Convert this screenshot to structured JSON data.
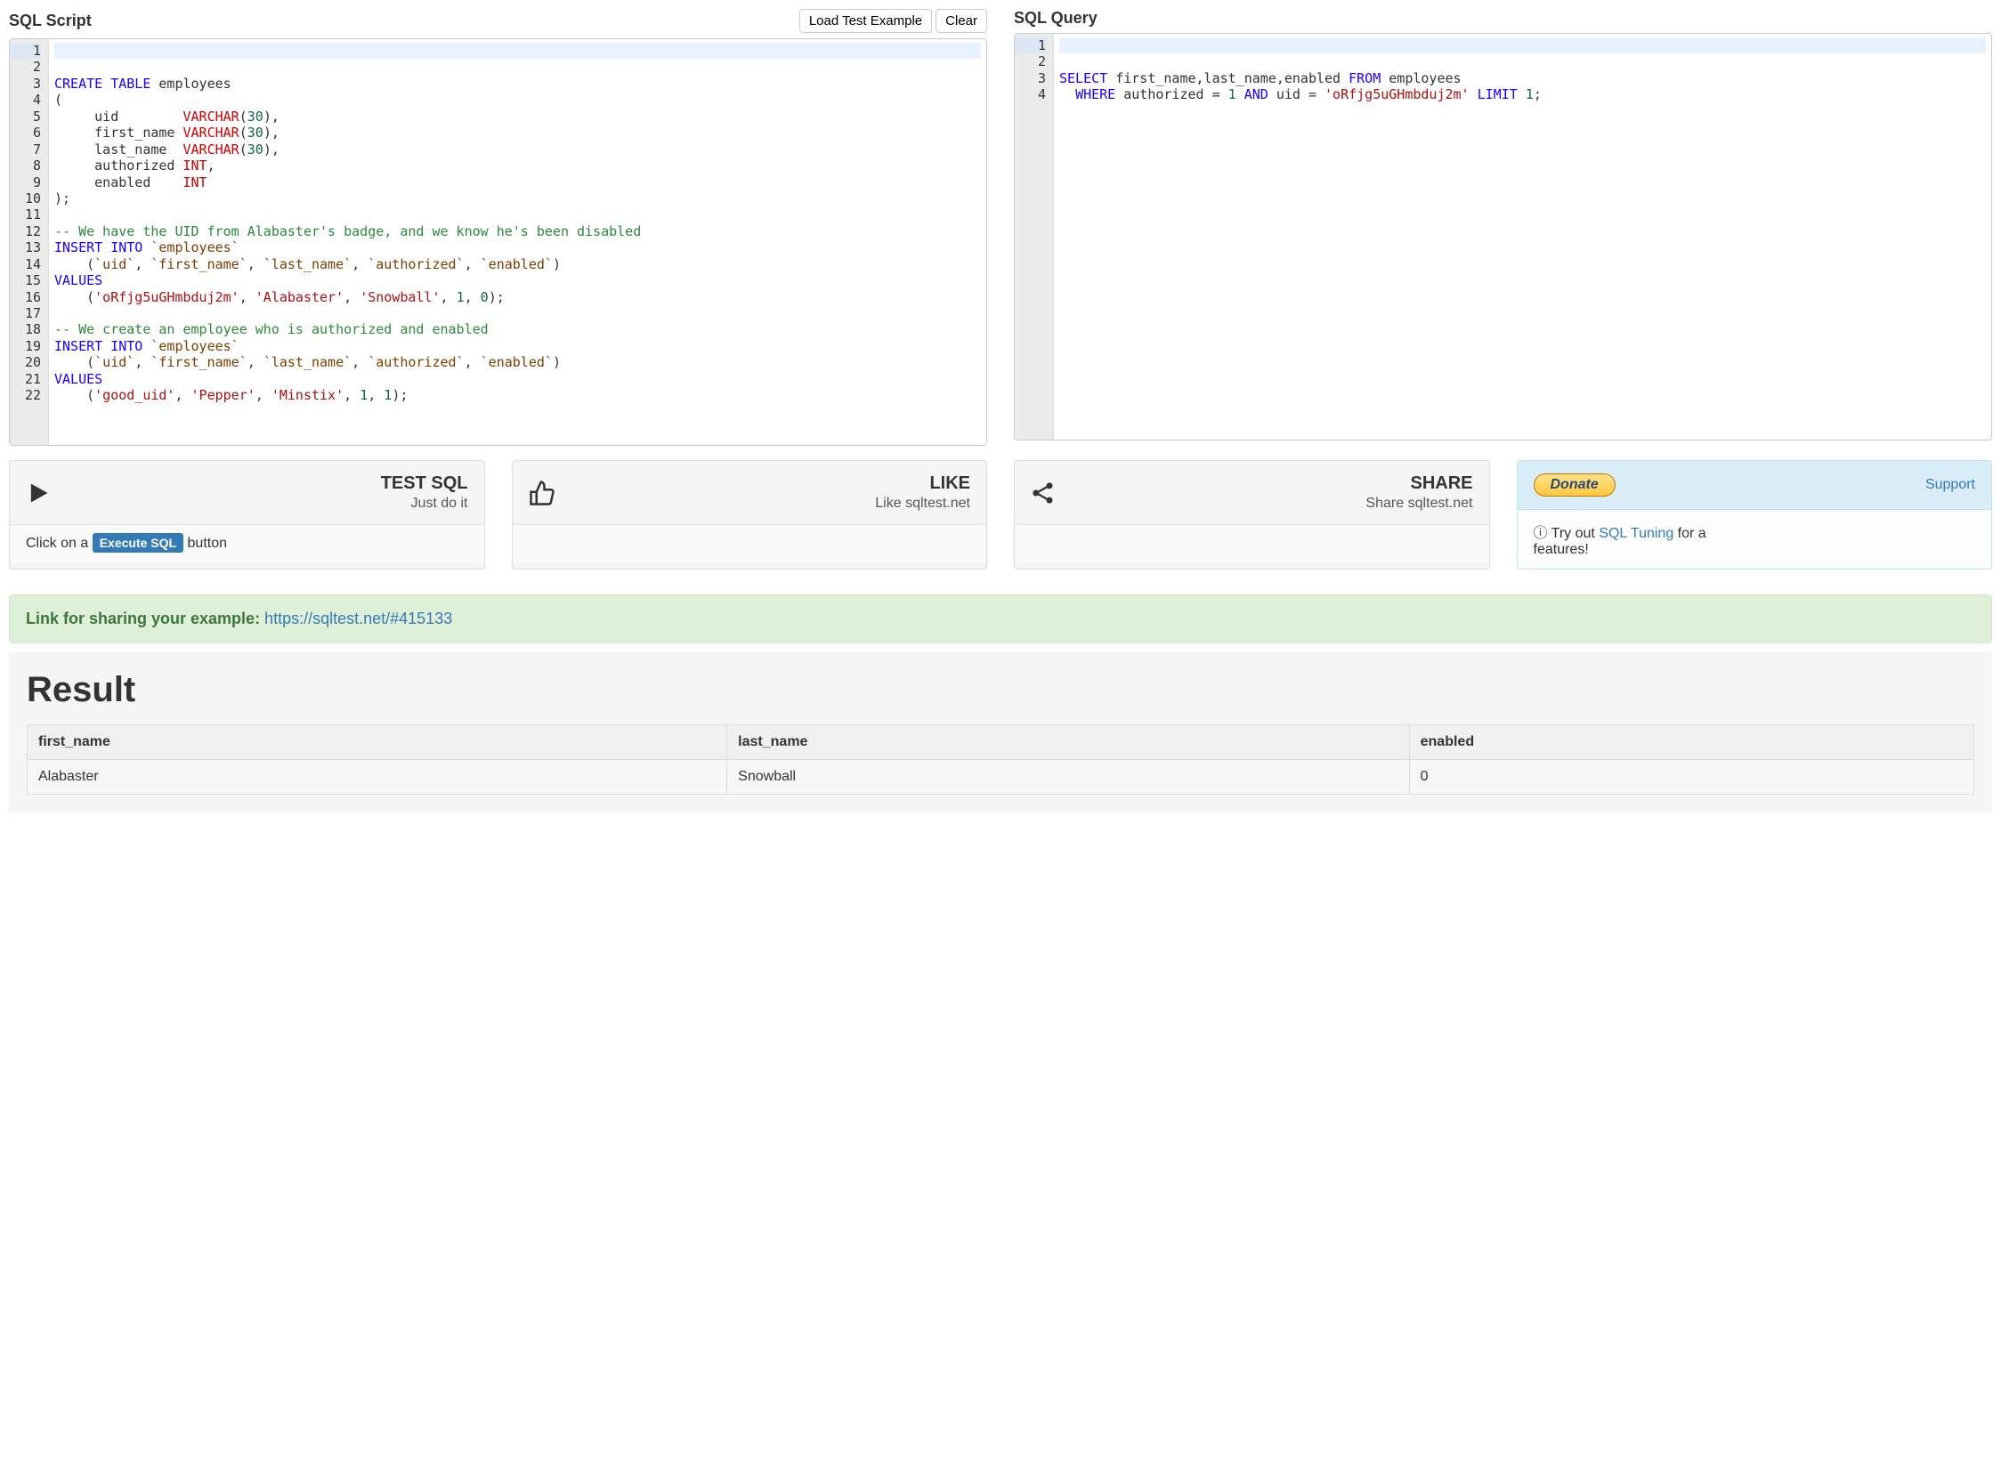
{
  "left": {
    "title": "SQL Script",
    "btn_load": "Load Test Example",
    "btn_clear": "Clear",
    "lines": 22,
    "tokens": [
      [],
      [],
      [
        {
          "t": "CREATE",
          "c": "kw"
        },
        {
          "t": " "
        },
        {
          "t": "TABLE",
          "c": "kw"
        },
        {
          "t": " employees"
        }
      ],
      [
        {
          "t": "("
        }
      ],
      [
        {
          "t": "     uid        "
        },
        {
          "t": "VARCHAR",
          "c": "type"
        },
        {
          "t": "("
        },
        {
          "t": "30",
          "c": "num"
        },
        {
          "t": "),"
        }
      ],
      [
        {
          "t": "     first_name "
        },
        {
          "t": "VARCHAR",
          "c": "type"
        },
        {
          "t": "("
        },
        {
          "t": "30",
          "c": "num"
        },
        {
          "t": "),"
        }
      ],
      [
        {
          "t": "     last_name  "
        },
        {
          "t": "VARCHAR",
          "c": "type"
        },
        {
          "t": "("
        },
        {
          "t": "30",
          "c": "num"
        },
        {
          "t": "),"
        }
      ],
      [
        {
          "t": "     authorized "
        },
        {
          "t": "INT",
          "c": "type"
        },
        {
          "t": ","
        }
      ],
      [
        {
          "t": "     enabled    "
        },
        {
          "t": "INT",
          "c": "type"
        }
      ],
      [
        {
          "t": ");"
        }
      ],
      [],
      [
        {
          "t": "-- We have the UID from Alabaster's badge, and we know he's been disabled",
          "c": "com"
        }
      ],
      [
        {
          "t": "INSERT",
          "c": "kw"
        },
        {
          "t": " "
        },
        {
          "t": "INTO",
          "c": "kw"
        },
        {
          "t": " "
        },
        {
          "t": "`employees`",
          "c": "q"
        }
      ],
      [
        {
          "t": "    ("
        },
        {
          "t": "`uid`",
          "c": "q"
        },
        {
          "t": ", "
        },
        {
          "t": "`first_name`",
          "c": "q"
        },
        {
          "t": ", "
        },
        {
          "t": "`last_name`",
          "c": "q"
        },
        {
          "t": ", "
        },
        {
          "t": "`authorized`",
          "c": "q"
        },
        {
          "t": ", "
        },
        {
          "t": "`enabled`",
          "c": "q"
        },
        {
          "t": ")"
        }
      ],
      [
        {
          "t": "VALUES",
          "c": "kw"
        }
      ],
      [
        {
          "t": "    ("
        },
        {
          "t": "'oRfjg5uGHmbduj2m'",
          "c": "str"
        },
        {
          "t": ", "
        },
        {
          "t": "'Alabaster'",
          "c": "str"
        },
        {
          "t": ", "
        },
        {
          "t": "'Snowball'",
          "c": "str"
        },
        {
          "t": ", "
        },
        {
          "t": "1",
          "c": "num"
        },
        {
          "t": ", "
        },
        {
          "t": "0",
          "c": "num"
        },
        {
          "t": ");"
        }
      ],
      [],
      [
        {
          "t": "-- We create an employee who is authorized and enabled",
          "c": "com"
        }
      ],
      [
        {
          "t": "INSERT",
          "c": "kw"
        },
        {
          "t": " "
        },
        {
          "t": "INTO",
          "c": "kw"
        },
        {
          "t": " "
        },
        {
          "t": "`employees`",
          "c": "q"
        }
      ],
      [
        {
          "t": "    ("
        },
        {
          "t": "`uid`",
          "c": "q"
        },
        {
          "t": ", "
        },
        {
          "t": "`first_name`",
          "c": "q"
        },
        {
          "t": ", "
        },
        {
          "t": "`last_name`",
          "c": "q"
        },
        {
          "t": ", "
        },
        {
          "t": "`authorized`",
          "c": "q"
        },
        {
          "t": ", "
        },
        {
          "t": "`enabled`",
          "c": "q"
        },
        {
          "t": ")"
        }
      ],
      [
        {
          "t": "VALUES",
          "c": "kw"
        }
      ],
      [
        {
          "t": "    ("
        },
        {
          "t": "'good_uid'",
          "c": "str"
        },
        {
          "t": ", "
        },
        {
          "t": "'Pepper'",
          "c": "str"
        },
        {
          "t": ", "
        },
        {
          "t": "'Minstix'",
          "c": "str"
        },
        {
          "t": ", "
        },
        {
          "t": "1",
          "c": "num"
        },
        {
          "t": ", "
        },
        {
          "t": "1",
          "c": "num"
        },
        {
          "t": ");"
        }
      ]
    ]
  },
  "right": {
    "title": "SQL Query",
    "lines": 4,
    "tokens": [
      [],
      [],
      [
        {
          "t": "SELECT",
          "c": "kw"
        },
        {
          "t": " first_name,last_name,enabled "
        },
        {
          "t": "FROM",
          "c": "kw"
        },
        {
          "t": " employees"
        }
      ],
      [
        {
          "t": "  "
        },
        {
          "t": "WHERE",
          "c": "kw"
        },
        {
          "t": " authorized "
        },
        {
          "t": "=",
          "c": "op"
        },
        {
          "t": " "
        },
        {
          "t": "1",
          "c": "num"
        },
        {
          "t": " "
        },
        {
          "t": "AND",
          "c": "kw"
        },
        {
          "t": " uid "
        },
        {
          "t": "=",
          "c": "op"
        },
        {
          "t": " "
        },
        {
          "t": "'oRfjg5uGHmbduj2m'",
          "c": "str"
        },
        {
          "t": " "
        },
        {
          "t": "LIMIT",
          "c": "kw"
        },
        {
          "t": " "
        },
        {
          "t": "1",
          "c": "num"
        },
        {
          "t": ";"
        }
      ]
    ]
  },
  "cards": {
    "test": {
      "title": "TEST SQL",
      "sub": "Just do it",
      "foot_pre": "Click on a ",
      "foot_badge": "Execute SQL",
      "foot_post": " button"
    },
    "like": {
      "title": "LIKE",
      "sub": "Like sqltest.net"
    },
    "share": {
      "title": "SHARE",
      "sub": "Share sqltest.net"
    },
    "donate": {
      "btn": "Donate",
      "support": "Support",
      "tryout": "Try out ",
      "link": "SQL Tuning",
      "after": " for a",
      "features": "features!"
    }
  },
  "share_box": {
    "label": "Link for sharing your example: ",
    "url": "https://sqltest.net/#415133"
  },
  "result": {
    "title": "Result",
    "headers": [
      "first_name",
      "last_name",
      "enabled"
    ],
    "rows": [
      [
        "Alabaster",
        "Snowball",
        "0"
      ]
    ]
  }
}
